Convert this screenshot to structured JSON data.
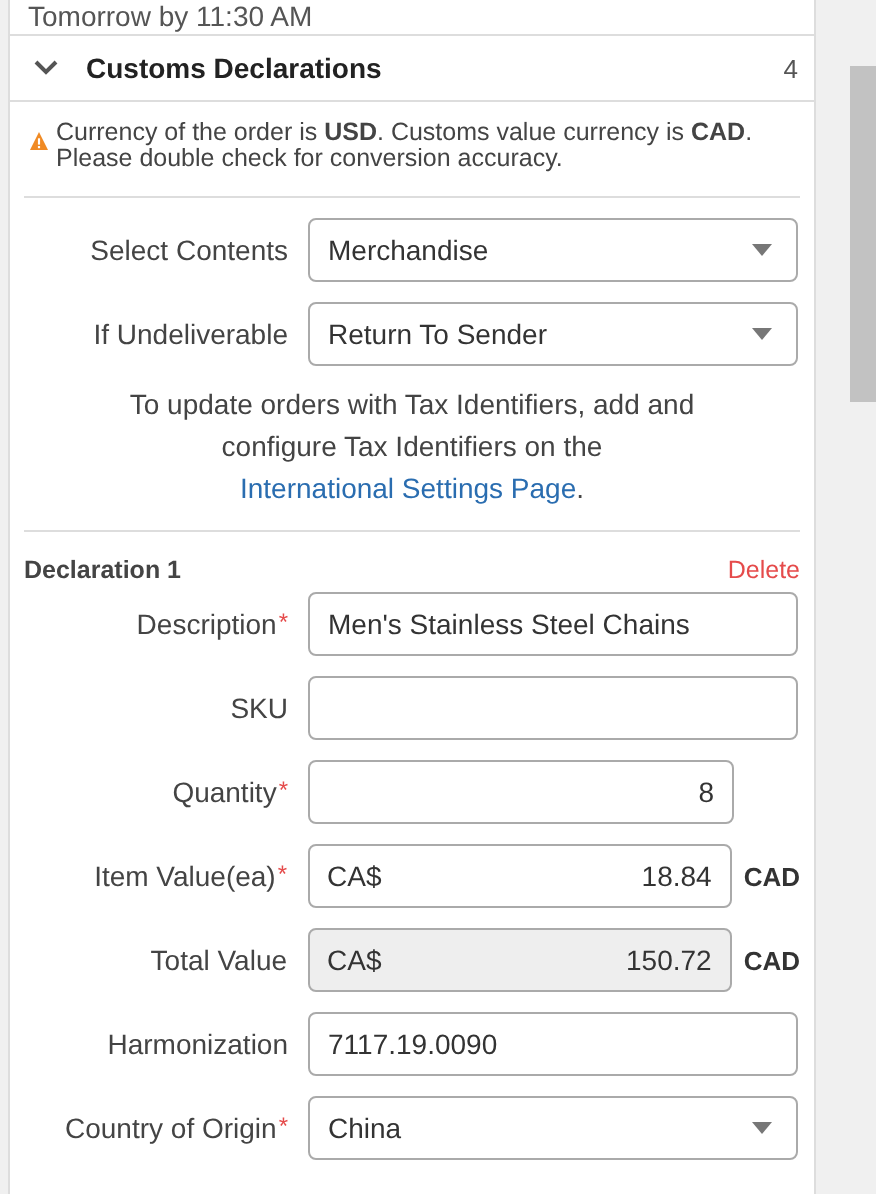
{
  "delivery_note": "Tomorrow by 11:30 AM",
  "section": {
    "title": "Customs Declarations",
    "expanded": true,
    "count": "4"
  },
  "warning": "Currency of the order is **USD**. Customs value currency is **CAD**. Please double check for conversion accuracy.",
  "general_fields": [
    {
      "kind": "select",
      "label": "Select Contents",
      "value": "Merchandise"
    },
    {
      "kind": "select",
      "label": "If Undeliverable",
      "value": "Return To Sender"
    }
  ],
  "info": {
    "text": "To update orders with Tax Identifiers, add and configure Tax Identifiers on the",
    "link": "International Settings Page",
    "end": "."
  },
  "declaration": {
    "title": "Declaration 1",
    "delete_label": "Delete",
    "fields": [
      {
        "kind": "text",
        "label": "Description",
        "required_mark": "*",
        "value": "Men's Stainless Steel Chains"
      },
      {
        "kind": "text",
        "label": "SKU"
      },
      {
        "kind": "number",
        "label": "Quantity",
        "required_mark": "*",
        "value": "8"
      },
      {
        "kind": "currency",
        "label": "Item Value(ea)",
        "required_mark": "*",
        "prefix": "CA$",
        "value": "18.84",
        "suffix": "CAD",
        "disabled": false
      },
      {
        "kind": "currency",
        "label": "Total Value",
        "prefix": "CA$",
        "value": "150.72",
        "suffix": "CAD",
        "disabled": true
      },
      {
        "kind": "text",
        "label": "Harmonization",
        "value": "7117.19.0090"
      },
      {
        "kind": "select",
        "label": "Country of Origin",
        "required_mark": "*",
        "value": "China"
      }
    ]
  }
}
